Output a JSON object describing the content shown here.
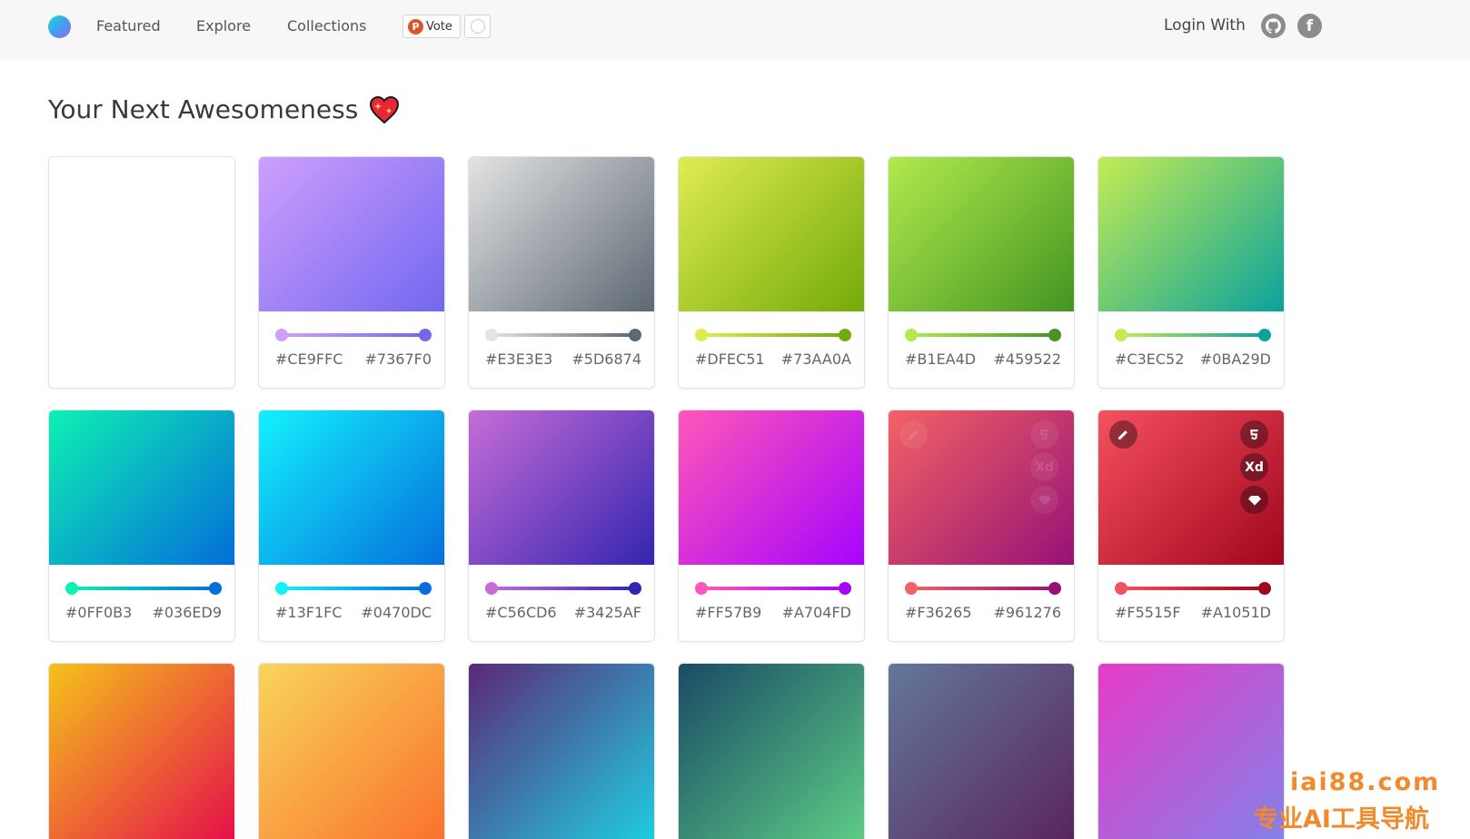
{
  "nav": {
    "links": [
      "Featured",
      "Explore",
      "Collections"
    ],
    "vote_label": "Vote",
    "vote_icon": "producthunt-icon",
    "login_label": "Login With",
    "social_icons": [
      "github-icon",
      "facebook-icon"
    ]
  },
  "page": {
    "title": "Your Next Awesomeness",
    "title_icon": "sparkling-heart-icon"
  },
  "colors": {
    "topbar": "#f7f7f7",
    "page_bg": "#ffffff",
    "card_border": "#e2e2e2",
    "watermark": "#f08a2c"
  },
  "gradients": [
    {
      "start": "",
      "end": "",
      "blank": true
    },
    {
      "start": "#CE9FFC",
      "end": "#7367F0"
    },
    {
      "start": "#E3E3E3",
      "end": "#5D6874"
    },
    {
      "start": "#DFEC51",
      "end": "#73AA0A"
    },
    {
      "start": "#B1EA4D",
      "end": "#459522"
    },
    {
      "start": "#C3EC52",
      "end": "#0BA29D"
    },
    {
      "start": "#0FF0B3",
      "end": "#036ED9"
    },
    {
      "start": "#13F1FC",
      "end": "#0470DC"
    },
    {
      "start": "#C56CD6",
      "end": "#3425AF"
    },
    {
      "start": "#FF57B9",
      "end": "#A704FD"
    },
    {
      "start": "#F36265",
      "end": "#961276",
      "faded_tools": true
    },
    {
      "start": "#F5515F",
      "end": "#A1051D",
      "tools": true
    },
    {
      "start": "#F5C21B",
      "end": "#E5104A",
      "hidden_hex": true
    },
    {
      "start": "#F9D45C",
      "end": "#F9722C",
      "hidden_hex": true
    },
    {
      "start": "#5B2877",
      "end": "#1FCDE0",
      "hidden_hex": true
    },
    {
      "start": "#1A4B66",
      "end": "#5CCB84",
      "hidden_hex": true
    },
    {
      "start": "#63779B",
      "end": "#59265F",
      "hidden_hex": true
    },
    {
      "start": "#E63BC8",
      "end": "#8580E8",
      "hidden_hex": true
    }
  ],
  "card_tools": [
    "edit-icon",
    "css3-icon",
    "adobe-xd-icon",
    "sketch-icon"
  ],
  "card_tool_labels": {
    "xd": "Xd"
  },
  "watermark": {
    "line1": "iai88.com",
    "line2": "专业AI工具导航"
  }
}
